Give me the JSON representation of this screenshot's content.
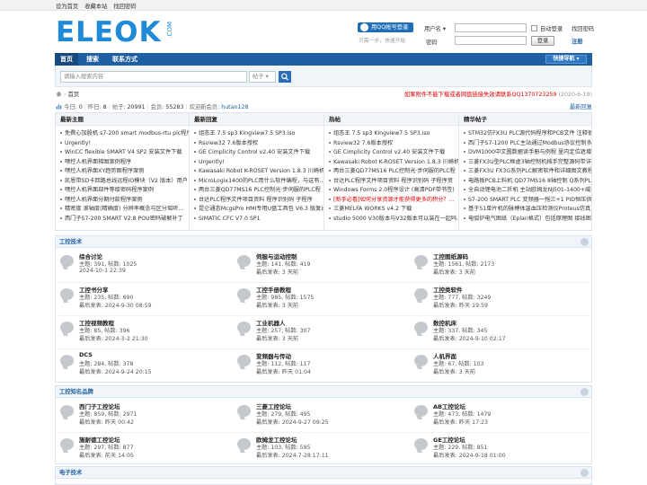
{
  "topbar": {
    "links": [
      "设为首页",
      "收藏本站",
      "找回密码"
    ]
  },
  "logo": {
    "text": "ELEOK",
    "suffix": ".COM"
  },
  "qq": {
    "button": "用QQ帐号登录",
    "sub": "只需一步，快速开始"
  },
  "login": {
    "username_type": "用户名",
    "password_label": "密码",
    "auto_login": "自动登录",
    "find_password": "找回密码",
    "login_button": "登录",
    "register": "注册"
  },
  "nav": {
    "items": [
      "首页",
      "搜索",
      "联系方式"
    ],
    "quick": "快捷导航"
  },
  "search": {
    "placeholder": "请输入搜索内容",
    "type": "帖子"
  },
  "breadcrumb": "首页",
  "notice": {
    "text": "如果附件不能下载或者网盘链接失效请联系QQ1370723259",
    "date": "(2020-6-19)"
  },
  "stats": {
    "today_label": "今日:",
    "today": "0",
    "yesterday_label": "昨日:",
    "yesterday": "8",
    "posts_label": "帖子:",
    "posts": "20991",
    "members_label": "会员:",
    "members": "55283",
    "welcome_label": "欢迎新会员:",
    "new_member": "hutan128"
  },
  "newest_link": "最新回复",
  "columns": [
    {
      "title": "最新主题",
      "items": [
        {
          "text": "免費心加股机 s7-200 smart modbus-rtu plc程序概"
        },
        {
          "text": "Urgently!"
        },
        {
          "text": "WinCC flexible SMART V4 SP2 安装文件下载"
        },
        {
          "text": "嘿控人机界面梯图案例程序"
        },
        {
          "text": "嘿控人机界面XY趋势图程序案例"
        },
        {
          "text": "凯恩带SD卡回路总线远程IO模块（V2 版本）用户"
        },
        {
          "text": "嘿控人机界面部件等级密码程序案例"
        },
        {
          "text": "嘿控人机界面分期付款程序案例"
        },
        {
          "text": "精密度 滚轴度(精确度) 分辨率概念与区分瑶听…"
        },
        {
          "text": "西门子S7-200 SMART V2.8 POU密码破解补丁"
        }
      ]
    },
    {
      "title": "最新回复",
      "items": [
        {
          "text": "组态王 7.5 sp3 Kingview7.5 SP3.iso"
        },
        {
          "text": "Rsview32 7.6版本授权"
        },
        {
          "text": "GE Cimplicity Control v2.40 安装文件下载"
        },
        {
          "text": "Urgently!"
        },
        {
          "text": "Kawasaki Robot K-ROSET Version 1.8.3 川崎机器"
        },
        {
          "text": "MicroLogix1400的PLC用什么软件编程，与这有…"
        },
        {
          "text": "两台三菱QD77MS16 PLC控制光·步伺服的PLC程"
        },
        {
          "text": "台达PLC程序文件项目资料 程序识别码 子程序"
        },
        {
          "text": "昆仑通态McgsPro HMI专用U盘工具包 V6.3 版复出"
        },
        {
          "text": "SIMATIC CFC V7.0 SP1"
        }
      ]
    },
    {
      "title": "热帖",
      "items": [
        {
          "text": "组态王 7.5 sp3 Kingview7.5 SP3.iso"
        },
        {
          "text": "Rsview32 7.6版本授权"
        },
        {
          "text": "GE Cimplicity Control v2.40 安装文件下载"
        },
        {
          "text": "Kawasaki Robot K-ROSET Version 1.8.3 川崎机器"
        },
        {
          "text": "两台三菱QD77MS16 PLC控制光·步伺服的PLC程"
        },
        {
          "text": "台达PLC程序文件项目资料 程序识别码 子程序资"
        },
        {
          "text": "Windows Forms 2.0程序设计 (高清PDF带书签)"
        },
        {
          "text": "[新手必看]如何分享资源才能获得更多的积分？…",
          "red": true
        },
        {
          "text": "三菱MELFA WORKS v4.2 下载"
        },
        {
          "text": "studio 5000 V30版本与V32版本可以装在一起吗…"
        }
      ]
    },
    {
      "title": "精华帖子",
      "items": [
        {
          "text": "STM32仿FX3U PLC源代码程序和PCB文件 注释很"
        },
        {
          "text": "西门子S7-1200 PLC主站通过Modbus协议控制多"
        },
        {
          "text": "DVM1000中文圆数据读手册与例程 里内定位遮增图"
        },
        {
          "text": "三菱FX3U型PLC框虚3轴控制机械手完整源码带详"
        },
        {
          "text": "三菱FX3U FX3G系列PLC解密软件和详细图文教程"
        },
        {
          "text": "电路板PCB上料机 QD77MS16 8轴控制 Q系列PLC"
        },
        {
          "text": "全自动锂电池二折机 主站欧姆龙NJ501-1400+威纶"
        },
        {
          "text": "S7-200 SMART PLC 变频器一拖三+1 PID恒压供"
        },
        {
          "text": "基于51单片机的脉搏体温血压检测仪Proteus仿真"
        },
        {
          "text": "电弧炉电气图纸（Eplan格式）包括原理图 接线图"
        }
      ]
    }
  ],
  "sections": [
    {
      "title": "工控技术",
      "forums": [
        {
          "name": "综合讨论",
          "stats": "主题: 391, 帖数: 1025",
          "last": "2024-10-1 22:39"
        },
        {
          "name": "伺服与运动控制",
          "stats": "主题: 141, 帖数: 419",
          "last": "最后发表: 3 天前"
        },
        {
          "name": "工控图纸源码",
          "stats": "主题: 1561, 帖数: 2173",
          "last": "最后发表: 3 天前"
        },
        {
          "name": "工控书分享",
          "stats": "主题: 235, 帖数: 690",
          "last": "最后发表: 2024-9-30 08:59"
        },
        {
          "name": "工控手册教程",
          "stats": "主题: 985, 帖数: 1575",
          "last": "最后发表: 3 天前"
        },
        {
          "name": "工控类软件",
          "stats": "主题: 777, 帖数: 3249",
          "last": "最后发表: 昨天 19:59"
        },
        {
          "name": "工控视频教程",
          "stats": "主题: 85, 帖数: 396",
          "last": "最后发表: 2024-3-2 21:30"
        },
        {
          "name": "工业机器人",
          "stats": "主题: 257, 帖数: 307",
          "last": "最后发表: 3 天前"
        },
        {
          "name": "数控机床",
          "stats": "主题: 337, 帖数: 345",
          "last": "最后发表: 2024-9-10 02:17"
        },
        {
          "name": "DCS",
          "stats": "主题: 284, 帖数: 378",
          "last": "最后发表: 2024-9-24 20:15"
        },
        {
          "name": "变频器与传动",
          "stats": "主题: 112, 帖数: 117",
          "last": "最后发表: 昨天 01:04"
        },
        {
          "name": "人机界面",
          "stats": "主题: 67, 帖数: 103",
          "last": "最后发表: 3 天前"
        }
      ]
    },
    {
      "title": "工控知名品牌",
      "forums": [
        {
          "name": "西门子工控论坛",
          "stats": "主题: 859, 帖数: 2971",
          "last": "最后发表: 昨天 00:42"
        },
        {
          "name": "三菱工控论坛",
          "stats": "主题: 279, 帖数: 495",
          "last": "最后发表: 2024-9-27 09:25"
        },
        {
          "name": "AB工控论坛",
          "stats": "主题: 473, 帖数: 1479",
          "last": "最后发表: 昨天 17:23"
        },
        {
          "name": "施耐德工控论坛",
          "stats": "主题: 297, 帖数: 877",
          "last": "最后发表: 前天 14:05"
        },
        {
          "name": "欧姆龙工控论坛",
          "stats": "主题: 103, 帖数: 595",
          "last": "最后发表: 2024-7-28 17:11"
        },
        {
          "name": "GE工控论坛",
          "stats": "主题: 229, 帖数: 851",
          "last": "最后发表: 2024-9-18 01:00"
        }
      ]
    },
    {
      "title": "电子技术",
      "forums": []
    }
  ],
  "colors": {
    "brand": "#1f8ad8",
    "nav": "#1f5fa3",
    "notice": "#dd0000"
  }
}
